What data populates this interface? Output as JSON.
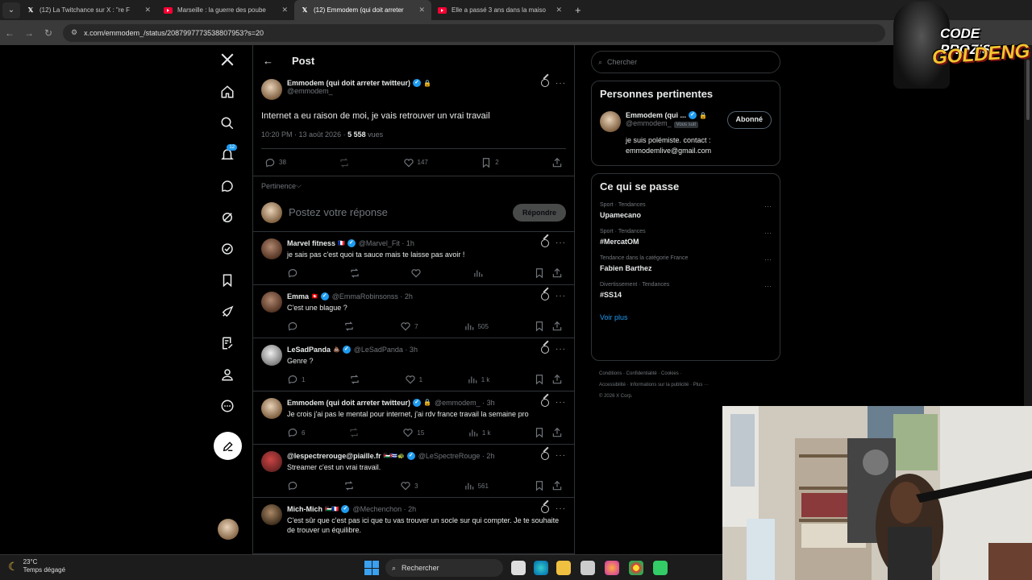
{
  "browser": {
    "tabs": [
      {
        "label": "(12) La Twitchance sur X : \"re F",
        "type": "x",
        "active": false
      },
      {
        "label": "Marseille : la guerre des poube",
        "type": "yt",
        "active": false
      },
      {
        "label": "(12) Emmodem (qui doit arreter",
        "type": "x",
        "active": true
      },
      {
        "label": "Elle a passé 3 ans dans la maiso",
        "type": "yt",
        "active": false
      }
    ],
    "url": "x.com/emmodem_/status/2087997773538807953?s=20"
  },
  "nav": {
    "notifications_count": "12"
  },
  "header": {
    "title": "Post"
  },
  "main_tweet": {
    "name": "Emmodem (qui doit arreter twitteur)",
    "handle": "@emmodem_",
    "text": "Internet a eu raison de moi, je vais retrouver un vrai travail",
    "time": "10:20 PM · 13 août 2026 · ",
    "views": "5 558",
    "views_label": " vues",
    "replies": "38",
    "likes": "147",
    "bookmarks": "2"
  },
  "sort_label": "Pertinence",
  "reply": {
    "placeholder": "Postez votre réponse",
    "button": "Répondre"
  },
  "replies": [
    {
      "name": "Marvel fitness",
      "flag": "🇫🇷",
      "sub": "@Marvel_Fit · 1h",
      "text": "je sais pas c'est quoi ta sauce mais te laisse pas avoir !",
      "replies": "",
      "likes": "",
      "views": "",
      "av": "b2"
    },
    {
      "name": "Emma",
      "flag": "🇨🇭",
      "sub": "@EmmaRobinsonss · 2h",
      "text": "C'est une blague ?",
      "replies": "",
      "likes": "7",
      "views": "505",
      "av": "b2"
    },
    {
      "name": "LeSadPanda",
      "flag": "💩",
      "sub": "@LeSadPanda · 3h",
      "text": "Genre ?",
      "replies": "1",
      "likes": "1",
      "views": "1 k",
      "av": "panda"
    },
    {
      "name": "Emmodem (qui doit arreter twitteur)",
      "flag": "",
      "sub": "@emmodem_ · 3h",
      "text": "Je crois j'ai pas le mental pour internet, j'ai rdv france travail la semaine pro",
      "replies": "6",
      "likes": "15",
      "views": "1 k",
      "av": ""
    },
    {
      "name": "@lespectrerouge@piaille.fr",
      "flag": "🇵🇸🇨🇺🐢",
      "sub": "@LeSpectreRouge · 2h",
      "text": "Streamer c'est un vrai travail.",
      "replies": "",
      "likes": "3",
      "views": "561",
      "av": "red"
    },
    {
      "name": "Mich-Mich",
      "flag": "🇵🇸🇫🇷",
      "sub": "@Mechenchon · 2h",
      "text": "C'est sûr que c'est pas ici que tu vas trouver un socle sur qui compter. Je te souhaite de trouver un équilibre.",
      "replies": "",
      "likes": "",
      "views": "",
      "av": "mm"
    }
  ],
  "sidebar": {
    "search_placeholder": "Chercher",
    "relevant_title": "Personnes pertinentes",
    "person": {
      "name": "Emmodem (qui ...",
      "handle": "@emmodem_",
      "follows_you": "Vous suit",
      "button": "Abonné",
      "bio": "je suis polémiste. contact : emmodemlive@gmail.com"
    },
    "trends_title": "Ce qui se passe",
    "trends": [
      {
        "cat": "Sport · Tendances",
        "name": "Upamecano"
      },
      {
        "cat": "Sport · Tendances",
        "name": "#MercatOM"
      },
      {
        "cat": "Tendance dans la catégorie France",
        "name": "Fabien Barthez"
      },
      {
        "cat": "Divertissement · Tendances",
        "name": "#SS14"
      }
    ],
    "see_more": "Voir plus",
    "footer_line1": "Conditions  ·  Confidentialité  ·  Cookies  ·",
    "footer_line2": "Accessibilité  ·  Informations sur la publicité  ·  Plus ···",
    "footer_line3": "© 2026 X Corp."
  },
  "overlay": {
    "line1": "CODE PROZIS",
    "line2": "GOLDENG"
  },
  "taskbar": {
    "temp": "23°C",
    "weather": "Temps dégagé",
    "search": "Rechercher"
  },
  "colors": {
    "accent": "#1d9bf0",
    "bg": "#000000",
    "border": "#2f3336",
    "muted": "#71767b"
  }
}
